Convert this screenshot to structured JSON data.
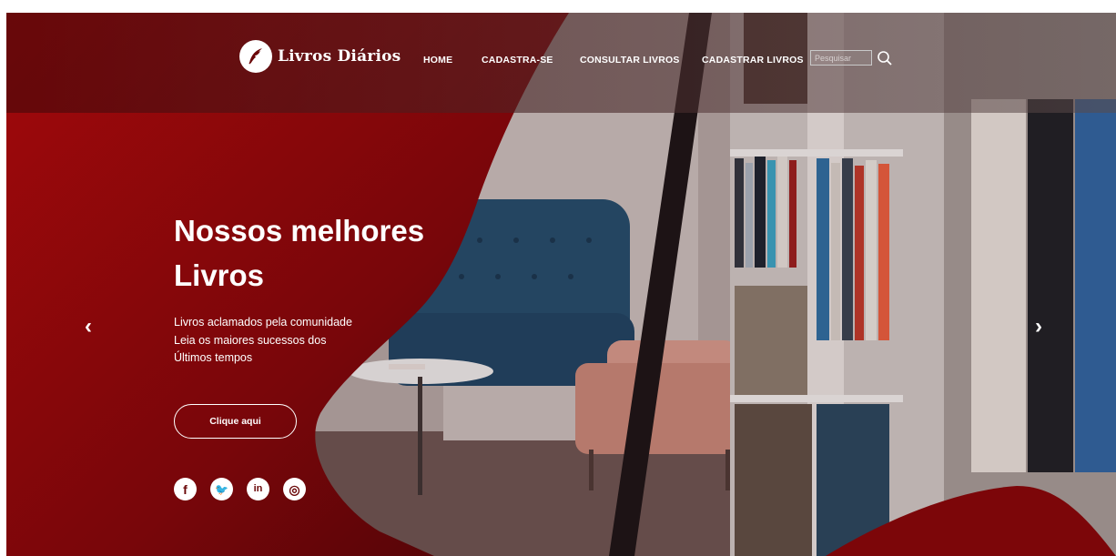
{
  "brand": {
    "name": "Livros Diários",
    "logo_icon": "feather-quill-icon"
  },
  "nav": {
    "items": [
      {
        "label": "HOME"
      },
      {
        "label": "CADASTRA-SE"
      },
      {
        "label": "CONSULTAR LIVROS"
      },
      {
        "label": "CADASTRAR LIVROS"
      }
    ]
  },
  "search": {
    "placeholder": "Pesquisar",
    "value": "",
    "icon": "search-icon"
  },
  "hero": {
    "title_line1": "Nossos melhores",
    "title_line2": "Livros",
    "text_line1": "Livros aclamados pela comunidade",
    "text_line2": "Leia os maiores sucessos dos",
    "text_line3": "Últimos tempos",
    "cta_label": "Clique aqui"
  },
  "social": {
    "facebook": {
      "glyph": "f",
      "icon": "facebook-icon"
    },
    "twitter": {
      "glyph": "🐦",
      "icon": "twitter-icon"
    },
    "linkedin": {
      "glyph": "in",
      "icon": "linkedin-icon"
    },
    "instagram": {
      "glyph": "◎",
      "icon": "instagram-icon"
    }
  },
  "carousel": {
    "prev_glyph": "‹",
    "next_glyph": "›"
  },
  "colors": {
    "brand_red": "#8a0608",
    "dark_red": "#4a0406",
    "text": "#ffffff"
  }
}
